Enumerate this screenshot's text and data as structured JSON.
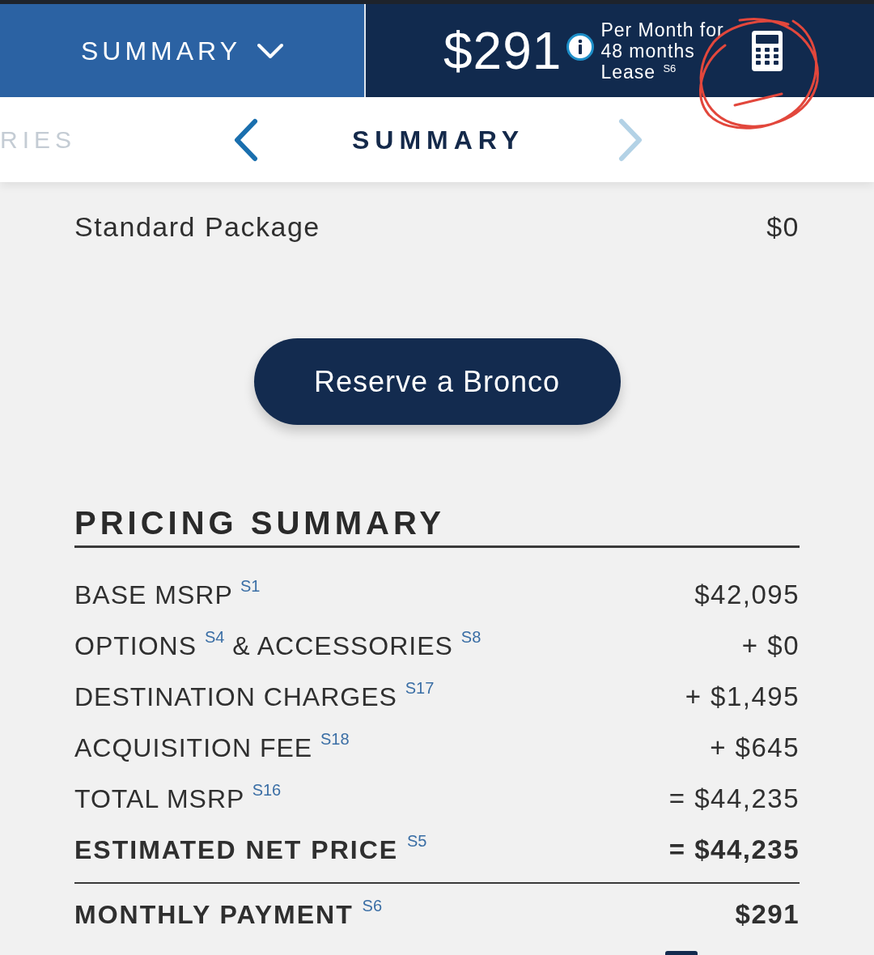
{
  "header": {
    "section_menu": {
      "label": "SUMMARY"
    },
    "payment": {
      "amount": "$291",
      "terms": [
        "Per Month for",
        "48 months",
        "Lease $^{S6}$"
      ]
    }
  },
  "section_nav": {
    "previous_label": "RIES",
    "title": "SUMMARY",
    "previous_arrow": {
      "disabled": false
    },
    "next_arrow": {
      "disabled": true
    }
  },
  "package": {
    "label": "Standard Package",
    "price": "$0"
  },
  "reserve_button": {
    "label": "Reserve a Bronco"
  },
  "pricing_summary": {
    "title": "PRICING SUMMARY",
    "rows": [
      {
        "kind": "item",
        "label": "BASE MSRP $^{S1}$",
        "value": "$42,095"
      },
      {
        "kind": "item",
        "label": "OPTIONS $^{S4}$ & ACCESSORIES $^{S8}$",
        "value": "+ $0"
      },
      {
        "kind": "item",
        "label": "DESTINATION CHARGES $^{S17}$",
        "value": "+ $1,495"
      },
      {
        "kind": "item",
        "label": "ACQUISITION FEE $^{S18}$",
        "value": "+ $645"
      },
      {
        "kind": "item",
        "label": "TOTAL MSRP $^{S16}$",
        "value": "= $44,235"
      },
      {
        "kind": "total",
        "label": "ESTIMATED NET PRICE $^{S5}$",
        "value": "= $44,235"
      }
    ],
    "monthly_payment": {
      "label": "MONTHLY PAYMENT $^{S6}$",
      "value": "$291"
    }
  }
}
